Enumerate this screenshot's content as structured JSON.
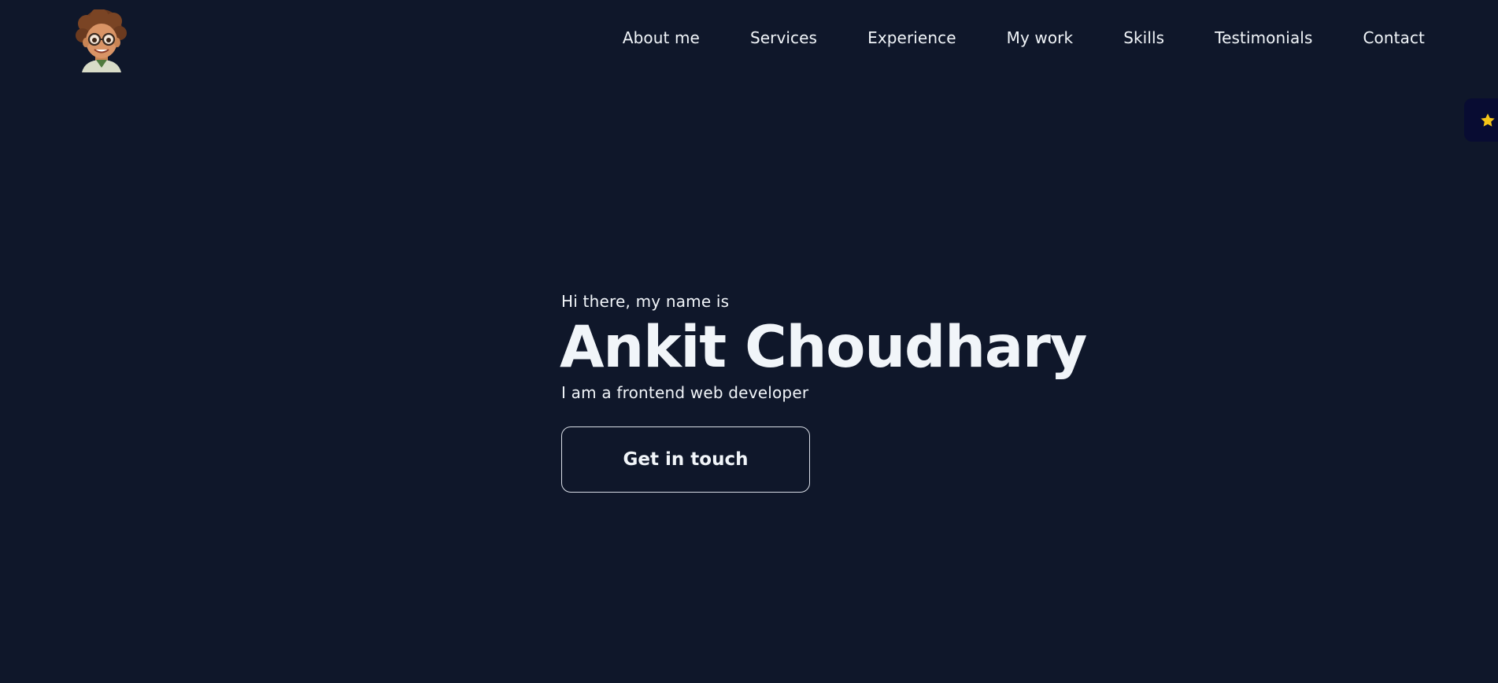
{
  "header": {
    "logo_icon": "avatar-boy-with-glasses-icon",
    "nav": [
      {
        "label": "About me"
      },
      {
        "label": "Services"
      },
      {
        "label": "Experience"
      },
      {
        "label": "My work"
      },
      {
        "label": "Skills"
      },
      {
        "label": "Testimonials"
      },
      {
        "label": "Contact"
      }
    ]
  },
  "side_widget": {
    "icon": "star-icon",
    "color": "#f5c518"
  },
  "hero": {
    "greeting": "Hi there, my name is",
    "name": "Ankit Choudhary",
    "tagline": "I am a frontend web developer",
    "cta_label": "Get in touch"
  },
  "colors": {
    "background": "#0f172a",
    "text": "#f1f5f9",
    "widget_bg": "#080c32"
  }
}
